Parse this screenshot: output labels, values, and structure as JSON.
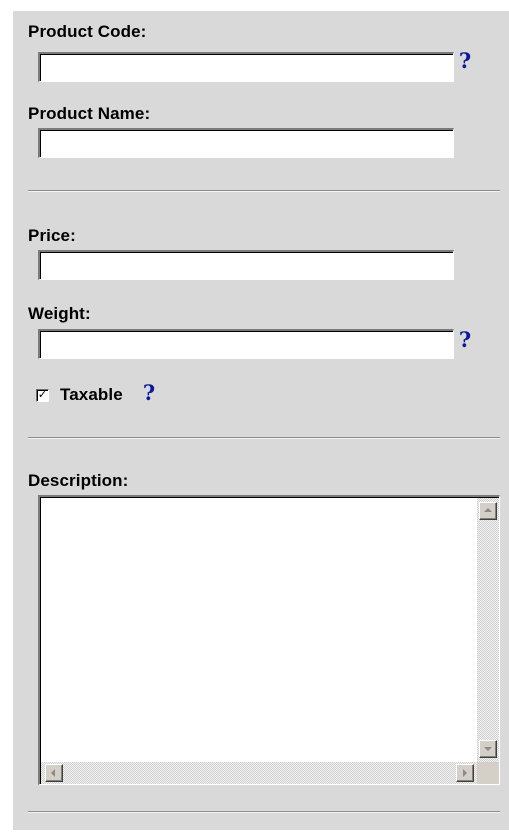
{
  "form": {
    "product_code": {
      "label": "Product Code:",
      "value": ""
    },
    "product_name": {
      "label": "Product Name:",
      "value": ""
    },
    "price": {
      "label": "Price:",
      "value": ""
    },
    "weight": {
      "label": "Weight:",
      "value": ""
    },
    "taxable": {
      "label": "Taxable",
      "checked": true,
      "mark": "✓"
    },
    "description": {
      "label": "Description:",
      "value": ""
    },
    "help_glyph": "?"
  },
  "colors": {
    "panel_bg": "#d9d9d9",
    "help_icon": "#0b1a99",
    "field_bg": "#ffffff",
    "divider": "#8c8c8c"
  },
  "icons": {
    "help": "question-mark-icon",
    "check": "checkmark-icon",
    "scroll_up": "arrow-up-icon",
    "scroll_down": "arrow-down-icon",
    "scroll_left": "arrow-left-icon",
    "scroll_right": "arrow-right-icon"
  }
}
